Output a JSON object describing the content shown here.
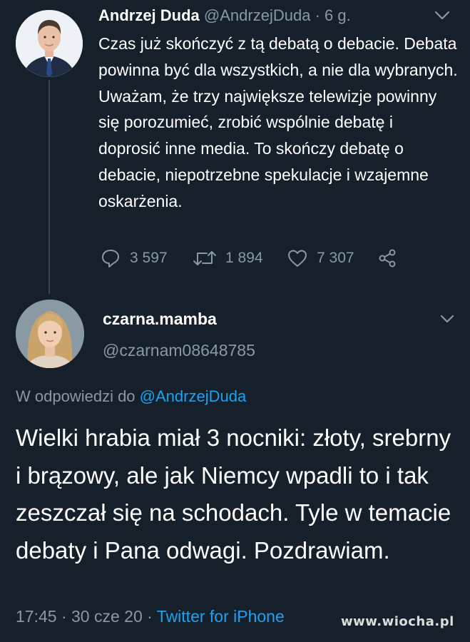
{
  "colors": {
    "background": "#15202b",
    "text": "#ffffff",
    "muted": "#8899a6",
    "link": "#1da1f2"
  },
  "original_tweet": {
    "author_name": "Andrzej Duda",
    "author_handle": "@AndrzejDuda",
    "time_separator": " · ",
    "age": "6 g.",
    "text": "Czas już skończyć z tą debatą o debacie. Debata powinna być dla wszystkich, a nie dla wybranych. Uważam, że trzy największe telewizje powinny się porozumieć, zrobić wspólnie debatę i doprosić inne media. To skończy debatę o debacie, niepotrzebne spekulacje i wzajemne oskarżenia.",
    "replies": "3 597",
    "retweets": "1 894",
    "likes": "7 307",
    "icons": [
      "reply-icon",
      "retweet-icon",
      "like-icon",
      "share-icon",
      "chevron-down-icon"
    ]
  },
  "reply_tweet": {
    "author_name": "czarna.mamba",
    "author_handle": "@czarnam08648785",
    "reply_prefix": "W odpowiedzi do ",
    "reply_to": "@AndrzejDuda",
    "text": "Wielki hrabia miał 3 nocniki: złoty, srebrny i brązowy, ale jak Niemcy wpadli to i tak zeszczał się na schodach. Tyle w temacie debaty i Pana odwagi. Pozdrawiam.",
    "time": "17:45",
    "separator": " · ",
    "date": "30 cze 20",
    "source": "Twitter for iPhone"
  },
  "watermark": "www.wiocha.pl"
}
